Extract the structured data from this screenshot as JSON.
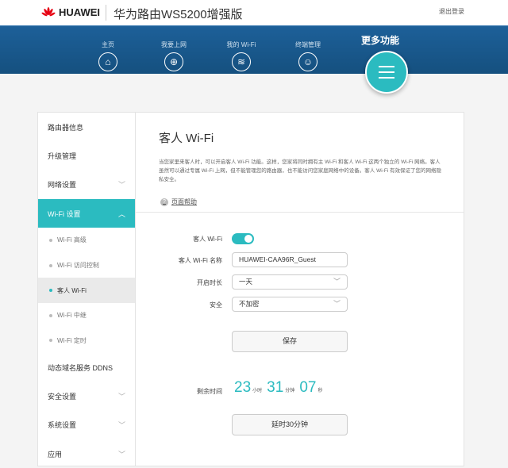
{
  "header": {
    "brand": "HUAWEI",
    "title": "华为路由WS5200增强版",
    "logout": "退出登录"
  },
  "nav": [
    {
      "label": "主页",
      "icon": "home-icon"
    },
    {
      "label": "我要上网",
      "icon": "globe-icon"
    },
    {
      "label": "我的 Wi-Fi",
      "icon": "wifi-icon"
    },
    {
      "label": "终端管理",
      "icon": "user-icon"
    }
  ],
  "more": "更多功能",
  "sidebar": {
    "items": [
      {
        "label": "路由器信息"
      },
      {
        "label": "升级管理"
      },
      {
        "label": "网络设置"
      },
      {
        "label": "Wi-Fi 设置"
      }
    ],
    "sub": [
      "Wi-Fi 高级",
      "Wi-Fi 访问控制",
      "客人 Wi-Fi",
      "Wi-Fi 中继",
      "Wi-Fi 定时"
    ],
    "after": [
      {
        "label": "动态域名服务 DDNS"
      },
      {
        "label": "安全设置"
      },
      {
        "label": "系统设置"
      },
      {
        "label": "应用"
      }
    ]
  },
  "main": {
    "title": "客人 Wi-Fi",
    "description": "当您家里来客人时，可以开启客人 Wi-Fi 功能。这样，您家将同时拥有主 Wi-Fi 和客人 Wi-Fi 这两个独立的 Wi-Fi 网络。客人虽然可以通过专属 Wi-Fi 上网，但不能管理您的路由器，也不能访问您家庭网络中的设备。客人 Wi-Fi 有效保证了您的网络隐私安全。",
    "help": "页面帮助",
    "guest_label": "客人 Wi-Fi",
    "guest_enabled": true,
    "name_label": "客人 Wi-Fi 名称",
    "name_value": "HUAWEI-CAA96R_Guest",
    "duration_label": "开启时长",
    "duration_value": "一天",
    "security_label": "安全",
    "security_value": "不加密",
    "save": "保存",
    "remaining_label": "剩余时间",
    "hours": "23",
    "hours_unit": "小时",
    "minutes": "31",
    "minutes_unit": "分钟",
    "seconds": "07",
    "seconds_unit": "秒",
    "extend": "延时30分钟"
  },
  "colors": {
    "accent": "#2bbbc0",
    "band": "#1a5a8e"
  }
}
